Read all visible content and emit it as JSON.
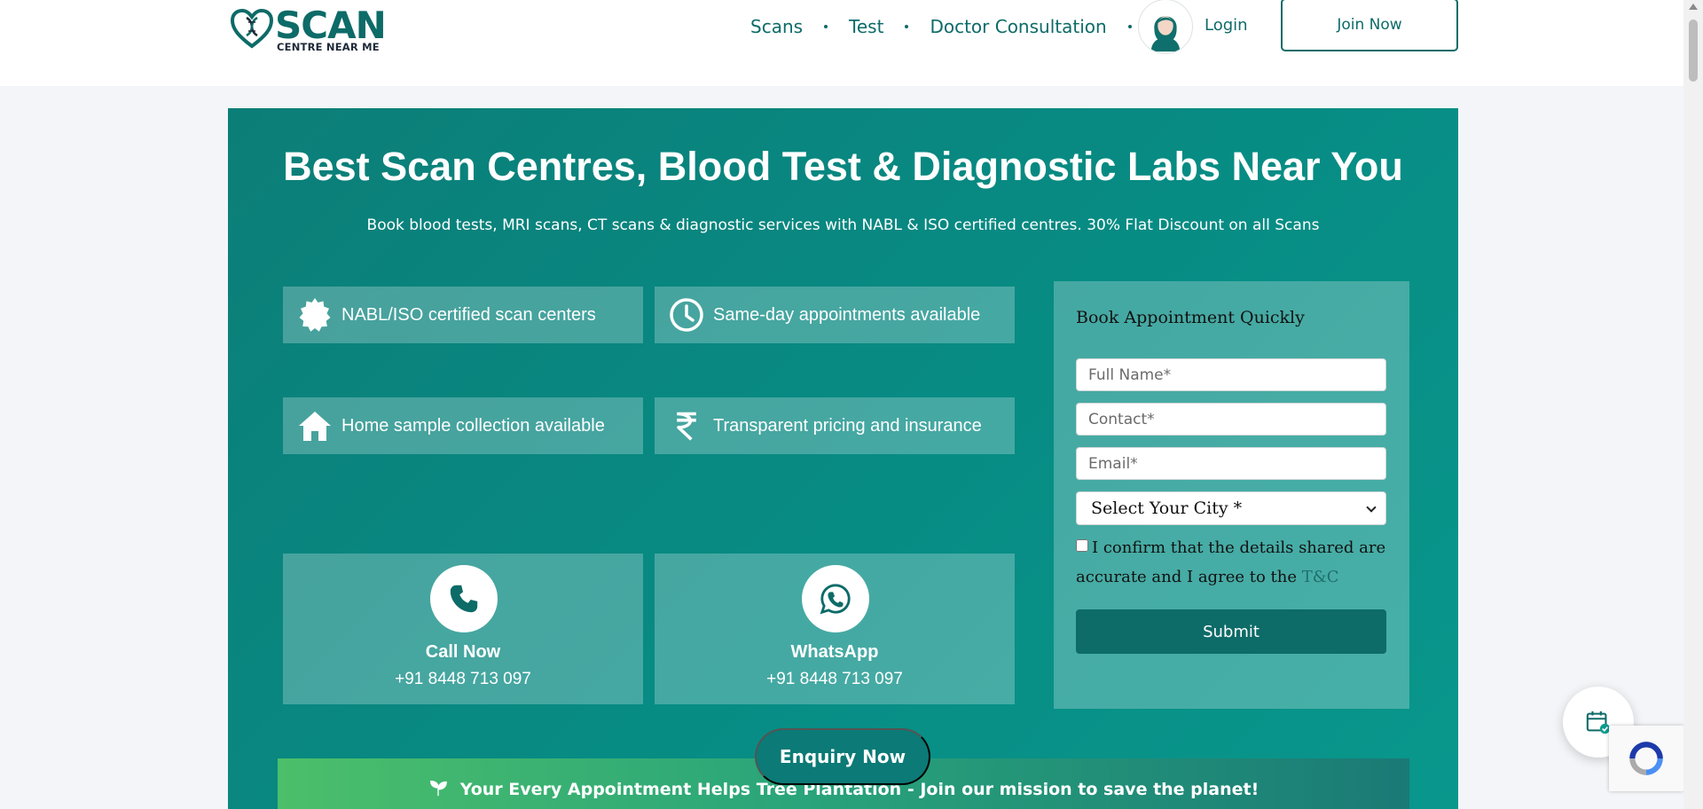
{
  "brand": {
    "logo_main": "SCAN",
    "logo_sub": "CENTRE NEAR ME"
  },
  "nav": {
    "items": [
      "Scans",
      "Test",
      "Doctor Consultation"
    ],
    "login": "Login",
    "join": "Join Now"
  },
  "hero": {
    "title": "Best Scan Centres, Blood Test & Diagnostic Labs Near You",
    "subtitle": "Book blood tests, MRI scans, CT scans & diagnostic services with NABL & ISO certified centres. 30% Flat Discount on all Scans"
  },
  "features": [
    {
      "icon": "badge-icon",
      "text": "NABL/ISO certified scan centers"
    },
    {
      "icon": "clock-icon",
      "text": "Same-day appointments available"
    },
    {
      "icon": "home-icon",
      "text": "Home sample collection available"
    },
    {
      "icon": "rupee-icon",
      "text": "Transparent pricing and insurance"
    }
  ],
  "contacts": [
    {
      "icon": "phone-icon",
      "title": "Call Now",
      "number": "+91 8448 713 097"
    },
    {
      "icon": "whatsapp-icon",
      "title": "WhatsApp",
      "number": "+91 8448 713 097"
    }
  ],
  "form": {
    "title": "Book Appointment Quickly",
    "name_placeholder": "Full Name*",
    "contact_placeholder": "Contact*",
    "email_placeholder": "Email*",
    "city_selected": "Select Your City *",
    "confirm_text": "I confirm that the details shared are accurate and I agree to the",
    "tc_link": "T&C",
    "submit": "Submit"
  },
  "enquiry": "Enquiry Now",
  "banner": {
    "text": "Your Every Appointment Helps Tree Plantation - Join our mission to save the planet!"
  },
  "colors": {
    "brand_teal": "#0d6b68",
    "hero_bg": "#078c84",
    "banner_green": "#4cbf6a"
  }
}
